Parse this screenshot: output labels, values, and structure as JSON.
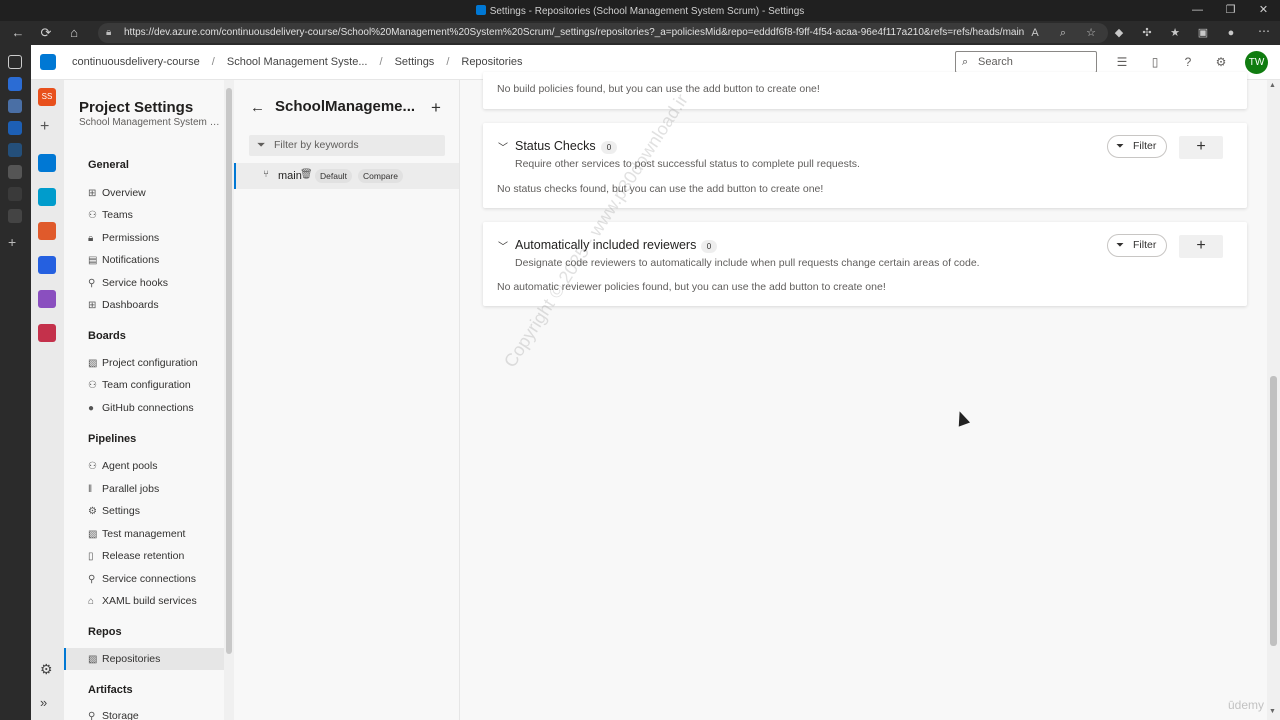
{
  "browser": {
    "window_title": "Settings - Repositories (School Management System Scrum) - Settings",
    "url": "https://dev.azure.com/continuousdelivery-course/School%20Management%20System%20Scrum/_settings/repositories?_a=policiesMid&repo=edddf6f8-f9ff-4f54-acaa-96e4f117a210&refs=refs/heads/main",
    "window_controls": [
      "—",
      "❐",
      "✕"
    ]
  },
  "header": {
    "breadcrumb": [
      "continuousdelivery-course",
      "School Management Syste...",
      "Settings",
      "Repositories"
    ],
    "search_placeholder": "Search",
    "avatar_initials": "TW"
  },
  "app_rail": {
    "project_initials": "SS"
  },
  "settings_nav": {
    "title": "Project Settings",
    "subtitle": "School Management System Sc...",
    "groups": {
      "general": {
        "label": "General",
        "items": [
          "Overview",
          "Teams",
          "Permissions",
          "Notifications",
          "Service hooks",
          "Dashboards"
        ]
      },
      "boards": {
        "label": "Boards",
        "items": [
          "Project configuration",
          "Team configuration",
          "GitHub connections"
        ]
      },
      "pipelines": {
        "label": "Pipelines",
        "items": [
          "Agent pools",
          "Parallel jobs",
          "Settings",
          "Test management",
          "Release retention",
          "Service connections",
          "XAML build services"
        ]
      },
      "repos": {
        "label": "Repos",
        "items": [
          "Repositories"
        ]
      },
      "artifacts": {
        "label": "Artifacts",
        "items": [
          "Storage"
        ]
      }
    }
  },
  "repo_pane": {
    "title": "SchoolManageme...",
    "filter_placeholder": "Filter by keywords",
    "branch": {
      "name": "main",
      "badge_default": "Default",
      "badge_compare": "Compare"
    }
  },
  "main": {
    "build_policies_empty": "No build policies found, but you can use the add button to create one!",
    "status_checks": {
      "title": "Status Checks",
      "count": "0",
      "description": "Require other services to post successful status to complete pull requests.",
      "empty": "No status checks found, but you can use the add button to create one!",
      "filter_label": "Filter"
    },
    "reviewers": {
      "title": "Automatically included reviewers",
      "count": "0",
      "description": "Designate code reviewers to automatically include when pull requests change certain areas of code.",
      "empty": "No automatic reviewer policies found, but you can use the add button to create one!",
      "filter_label": "Filter"
    }
  },
  "overlay": {
    "watermark": "Copyright © 2025 - www.p30download.ir",
    "udemy": "ūdemy"
  },
  "colors": {
    "accent": "#0078d4",
    "avatar": "#107c10",
    "project_tile": "#e8501c"
  }
}
